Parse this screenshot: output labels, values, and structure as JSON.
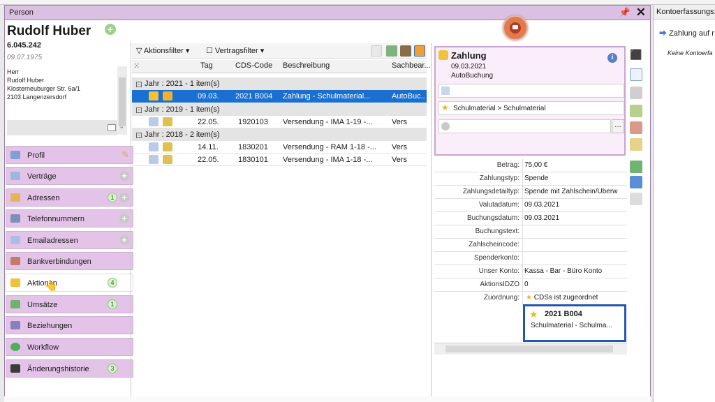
{
  "window": {
    "title": "Person"
  },
  "person": {
    "name": "Rudolf Huber",
    "number": "6.045.242",
    "birthdate": "09.07.1975",
    "address_lines": [
      "Herr",
      "Rudolf Huber",
      "Klosterneuburger Str. 6a/1",
      "2103 Langenzersdorf"
    ]
  },
  "nav": [
    {
      "label": "Profil"
    },
    {
      "label": "Verträge"
    },
    {
      "label": "Adressen",
      "count": "1"
    },
    {
      "label": "Telefonnummern"
    },
    {
      "label": "Emailadressen"
    },
    {
      "label": "Bankverbindungen"
    },
    {
      "label": "Aktionen",
      "count": "4"
    },
    {
      "label": "Umsätze",
      "count": "1"
    },
    {
      "label": "Beziehungen"
    },
    {
      "label": "Workflow"
    },
    {
      "label": "Änderungshistorie",
      "count": "3"
    }
  ],
  "toolbar": {
    "filter1": "Aktionsfilter",
    "filter2": "Vertragsfilter"
  },
  "grid": {
    "headers": [
      "Tag",
      "CDS-Code",
      "Beschreibung",
      "Sachbear..."
    ],
    "groups": [
      {
        "label": "Jahr : 2021 - 1 item(s)"
      },
      {
        "label": "Jahr : 2019 - 1 item(s)"
      },
      {
        "label": "Jahr : 2018 - 2 item(s)"
      }
    ],
    "rows": [
      {
        "tag": "09.03.",
        "code": "2021 B004",
        "desc": "Zahlung - Schulmaterial...",
        "sb": "AutoBuc..."
      },
      {
        "tag": "22.05.",
        "code": "1920103",
        "desc": "Versendung - IMA 1-19 -...",
        "sb": "Vers"
      },
      {
        "tag": "14.11.",
        "code": "1830201",
        "desc": "Versendung - RAM 1-18 -...",
        "sb": "Vers"
      },
      {
        "tag": "22.05.",
        "code": "1830101",
        "desc": "Versendung - IMA 1-18 -...",
        "sb": "Vers"
      }
    ]
  },
  "detail": {
    "title": "Zahlung",
    "date": "09.03.2021",
    "type": "AutoBuchung",
    "category": "Schulmaterial  >  Schulmaterial",
    "properties": [
      {
        "key": "Betrag:",
        "value": "75,00 €"
      },
      {
        "key": "Zahlungstyp:",
        "value": "Spende"
      },
      {
        "key": "Zahlungsdetailtyp:",
        "value": "Spende mit Zahlschein/Überw"
      },
      {
        "key": "Valutadatum:",
        "value": "09.03.2021"
      },
      {
        "key": "Buchungsdatum:",
        "value": "09.03.2021"
      },
      {
        "key": "Buchungstext:",
        "value": ""
      },
      {
        "key": "Zahlscheincode:",
        "value": ""
      },
      {
        "key": "Spenderkonto:",
        "value": ""
      },
      {
        "key": "Unser Konto:",
        "value": "Kassa - Bar - Büro Konto"
      },
      {
        "key": "AktionsIDZO",
        "value": "0"
      },
      {
        "key": "Zuordnung:",
        "value": "CDSs ist zugeordnet"
      }
    ],
    "cds_card": {
      "code": "2021 B004",
      "desc": "Schulmaterial - Schulma..."
    }
  },
  "konto_panel": {
    "title": "Kontoerfassungs:",
    "item": "Zahlung auf r",
    "empty": "Keine Kontoerfa"
  },
  "colors": {
    "accent": "#dcc0e2",
    "selection": "#1b6fd1",
    "card_border": "#2256b3"
  }
}
